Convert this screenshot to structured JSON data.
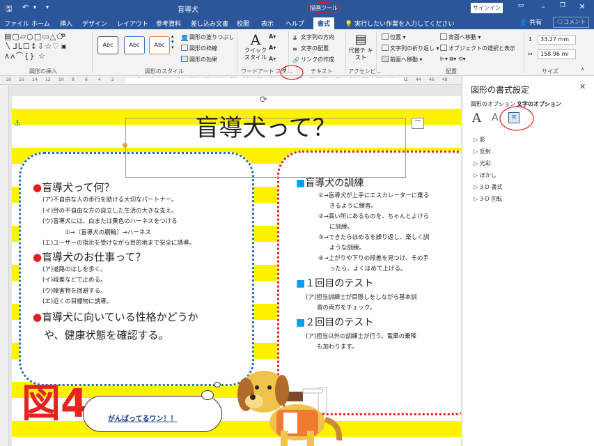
{
  "titlebar": {
    "doc_title": "盲導犬",
    "tools_title": "描画ツール",
    "signin": "サインイン"
  },
  "tabs": [
    "ファイル",
    "ホーム",
    "挿入",
    "デザイン",
    "レイアウト",
    "参考資料",
    "差し込み文書",
    "校閲",
    "表示",
    "ヘルプ",
    "書式"
  ],
  "tell_me": "実行したい作業を入力してください",
  "share": "共有",
  "comment": "コメント",
  "ribbon": {
    "insert_shapes_label": "図形の挿入",
    "shape_styles_label": "図形のスタイル",
    "style_samples": [
      "Abc",
      "Abc",
      "Abc"
    ],
    "shape_fill": "図形の塗りつぶし",
    "shape_outline": "図形の枠線",
    "shape_effects": "図形の効果",
    "quick_style": "クイック スタイル",
    "wordart_label": "ワードアート スタ...",
    "text_direction": "文字列の方向",
    "text_align": "文字の配置",
    "create_link": "リンクの作成",
    "text_label": "テキスト",
    "alt_text": "代替テ キスト",
    "accessibility_label": "アクセシビ...",
    "position": "位置",
    "wrap_text": "文字列の折り返し",
    "bring_forward": "前面へ移動",
    "send_backward": "背面へ移動",
    "selection_pane": "オブジェクトの選択と表示",
    "arrange_label": "配置",
    "height": "33.27 mm",
    "width": "158.96 mi",
    "size_label": "サイズ"
  },
  "ruler_ticks": [
    "18",
    "16",
    "14",
    "12",
    "10",
    "8",
    "6",
    "4",
    "2",
    "",
    "2",
    "4",
    "6",
    "8",
    "10",
    "12",
    "14",
    "16",
    "18",
    "20",
    "22",
    "24",
    "26",
    "28",
    "30",
    "32",
    "34",
    "36",
    "38",
    "40",
    "42",
    "44",
    "46",
    "48"
  ],
  "document": {
    "title": "盲導犬って？",
    "left": {
      "h1": "盲導犬って何？",
      "items1": [
        "(ア)不自由な人の歩行を助ける大切なパートナー。",
        "(イ)目の不自由な方の自立した生活の大きな支え。",
        "(ウ)盲導犬には、白または黄色のハーネスをつける",
        "①→（盲導犬の胴輪）→ハーネス",
        "(エ)ユーザーの指示を受けながら目的地まで安全に誘導。"
      ],
      "h2": "盲導犬のお仕事って？",
      "items2": [
        "(ア)道路のはしを歩く。",
        "(イ)段差などで止める。",
        "(ウ)障害物を回避する。",
        "(エ)近くの目標物に誘導。"
      ],
      "h3a": "盲導犬に向いている性格かどうか",
      "h3b": "や、健康状態を確認する。"
    },
    "right": {
      "h1": "盲導犬の訓練",
      "items1": [
        "①→盲導犬が上手にエスカレーターに乗る",
        "きるように練習。",
        "②→高い所にあるものを、ちゃんとよけら",
        "に訓練。",
        "③→できたらほめるを繰り返し、楽しく訓",
        "ような訓練。",
        "④→上がりや下りの段差を見つけ、その手",
        "ったら、よくほめて上げる。"
      ],
      "h2": "１回目のテスト",
      "items2": [
        "(ア)担当訓練士が目隠しをしながら基本訓",
        "習の両方をチェック。"
      ],
      "h3": "２回目のテスト",
      "items3": [
        "(ア)担当以外の訓練士が行う。電車の乗降",
        "も加わります。"
      ]
    },
    "figure_label": "図4",
    "cloud_text": "がんばってるワン！！"
  },
  "pane": {
    "title": "図形の書式設定",
    "tab_shape": "図形のオプション",
    "tab_text": "文字のオプション",
    "options": [
      "影",
      "反射",
      "光彩",
      "ぼかし",
      "3-D 書式",
      "3-D 回転"
    ]
  }
}
